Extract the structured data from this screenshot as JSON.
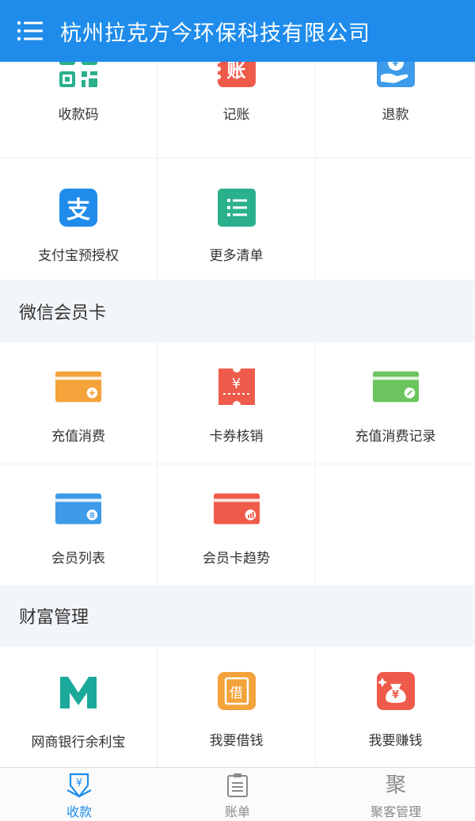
{
  "header": {
    "title": "杭州拉克方今环保科技有限公司",
    "menu_icon": "menu-list-icon"
  },
  "top_grid": {
    "items": [
      {
        "label": "收款码",
        "icon": "qr-code-icon"
      },
      {
        "label": "记账",
        "icon": "ledger-icon",
        "icon_text": "账"
      },
      {
        "label": "退款",
        "icon": "refund-hand-icon",
        "icon_text": "¥"
      },
      {
        "label": "支付宝预授权",
        "icon": "alipay-icon",
        "icon_text": "支"
      },
      {
        "label": "更多清单",
        "icon": "list-icon"
      }
    ]
  },
  "sections": [
    {
      "title": "微信会员卡",
      "items": [
        {
          "label": "充值消费",
          "icon": "recharge-card-icon"
        },
        {
          "label": "卡券核销",
          "icon": "coupon-icon",
          "icon_text": "¥"
        },
        {
          "label": "充值消费记录",
          "icon": "record-card-icon"
        },
        {
          "label": "会员列表",
          "icon": "member-card-icon"
        },
        {
          "label": "会员卡趋势",
          "icon": "trend-card-icon"
        }
      ]
    },
    {
      "title": "财富管理",
      "items": [
        {
          "label": "网商银行余利宝",
          "icon": "mybank-icon"
        },
        {
          "label": "我要借钱",
          "icon": "loan-icon",
          "icon_text": "借"
        },
        {
          "label": "我要赚钱",
          "icon": "money-bag-icon",
          "icon_text": "¥"
        }
      ]
    }
  ],
  "tabbar": {
    "tabs": [
      {
        "label": "收款",
        "icon": "receive-money-icon",
        "active": true
      },
      {
        "label": "账单",
        "icon": "bill-icon",
        "active": false
      },
      {
        "label": "聚客管理",
        "icon": "customer-icon",
        "icon_text": "聚",
        "active": false
      }
    ]
  },
  "colors": {
    "primary": "#1f8ceb",
    "green": "#2bb08c",
    "red": "#ef5b4b",
    "orange": "#f4a23a",
    "light_green": "#6cc45e",
    "blue_card": "#3d9be9"
  }
}
